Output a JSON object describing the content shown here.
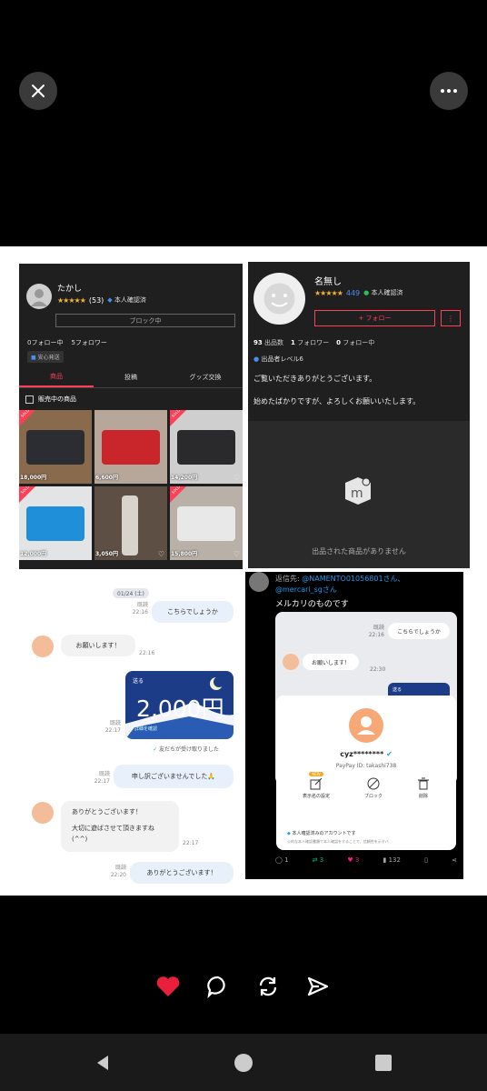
{
  "viewer": {
    "close_icon": "close-icon",
    "more_icon": "more-horizontal-icon"
  },
  "panel1": {
    "name": "たかし",
    "rating_count": "(53)",
    "verified": "本人確認済",
    "block_label": "ブロック中",
    "following": "0フォロー中",
    "followers": "5フォロワー",
    "safe_badge": "安心発送",
    "tabs": [
      "商品",
      "投稿",
      "グッズ交換"
    ],
    "filter_label": "販売中の商品",
    "sold_label": "SOLD",
    "products": [
      {
        "price": "18,000円",
        "sold": true,
        "color": "#2b2d33"
      },
      {
        "price": "6,600円",
        "sold": false,
        "color": "#c8262b"
      },
      {
        "price": "14,200円",
        "sold": true,
        "color": "#2a2a2c"
      },
      {
        "price": "12,000円",
        "sold": true,
        "color": "#1e8fd8"
      },
      {
        "price": "3,050円",
        "sold": false,
        "color": "#d8d4cc"
      },
      {
        "price": "15,800円",
        "sold": true,
        "color": "#e8e8e8"
      }
    ]
  },
  "panel2": {
    "name": "名無し",
    "rating_count": "449",
    "verified": "本人確認済",
    "follow_label": "+ フォロー",
    "more_label": "⋮",
    "listings": "93",
    "listings_label": "出品数",
    "followers": "1",
    "followers_label": "フォロワー",
    "following": "0",
    "following_label": "フォロー中",
    "level": "出品者レベル6",
    "bio_line1": "ご覧いただきありがとうございます。",
    "bio_line2": "始めたばかりですが、よろしくお願いいたします。",
    "empty_text": "出品された商品がありません"
  },
  "panel3": {
    "date": "01/24 (土)",
    "msg1": "こちらでしょうか",
    "msg1_meta_read": "既読",
    "msg1_meta_time": "22:16",
    "msg2": "お願いします！",
    "msg2_time": "22:16",
    "gift_label": "送る",
    "gift_amount": "2,000円",
    "gift_sub": "詳細を確認",
    "gift_meta_read": "既読",
    "gift_meta_time": "22:17",
    "received": "友だちが受け取りました",
    "msg3": "申し訳ございませんでした🙏",
    "msg3_meta_read": "既読",
    "msg3_meta_time": "22:17",
    "msg4_line1": "ありがとうございます！",
    "msg4_line2": "大切に遊ばさせて頂きますね",
    "msg4_line3": "(^^)",
    "msg4_time": "22:17",
    "msg5": "ありがとうございます！",
    "msg5_meta_read": "既読",
    "msg5_meta_time": "22:20"
  },
  "panel4": {
    "reply_prefix": "返信先: ",
    "reply_handle": "@NAMENTO01056801さん、",
    "reply_handle2": "@mercari_sgさん",
    "post_text": "メルカリのものです",
    "embed_msg1": "こちらでしょうか",
    "embed_read": "既読",
    "embed_time": "22:16",
    "embed_msg2": "お願いします！",
    "embed_time2": "22:30",
    "embed_gift": "送る",
    "pp_name": "cyz********",
    "pp_id": "PayPay ID: takashi738",
    "new_badge": "NEW",
    "act1": "表示名の設定",
    "act2": "ブロック",
    "act3": "削除",
    "verify_text": "本人確認済みのアカウントです",
    "verify_sub": "公的な本人確認書類で本人確認をすることで、信頼性を示すバ",
    "replies": "1",
    "retweets": "3",
    "likes": "3",
    "views": "132"
  },
  "actions": {
    "like_icon": "heart-icon",
    "comment_icon": "comment-icon",
    "repost_icon": "repost-icon",
    "share_icon": "send-icon"
  },
  "colors": {
    "mercari_red": "#ff3f56",
    "like_red": "#e8203c",
    "paypay_avatar": "#f6a976",
    "twitter_blue": "#1d9bf0"
  }
}
